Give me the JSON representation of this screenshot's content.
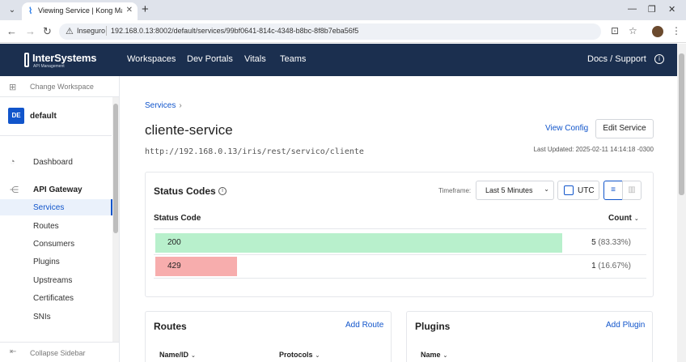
{
  "browser": {
    "tab_title": "Viewing Service | Kong Manager",
    "insecure_label": "Inseguro",
    "url": "192.168.0.13:8002/default/services/99bf0641-814c-4348-b8bc-8f8b7eba56f5"
  },
  "header": {
    "logo": "InterSystems",
    "logo_sub": "API Management",
    "nav": [
      "Workspaces",
      "Dev Portals",
      "Vitals",
      "Teams"
    ],
    "docs": "Docs / Support"
  },
  "sidebar": {
    "change_workspace": "Change Workspace",
    "workspace_badge": "DE",
    "workspace_name": "default",
    "dashboard": "Dashboard",
    "api_gateway": "API Gateway",
    "items": [
      "Services",
      "Routes",
      "Consumers",
      "Plugins",
      "Upstreams",
      "Certificates",
      "SNIs"
    ],
    "collapse": "Collapse Sidebar"
  },
  "service": {
    "breadcrumb": "Services",
    "name": "cliente-service",
    "url": "http://192.168.0.13/iris/rest/servico/cliente",
    "last_updated": "Last Updated: 2025-02-11 14:14:18 -0300",
    "view_config": "View Config",
    "edit_service": "Edit Service"
  },
  "status_codes": {
    "title": "Status Codes",
    "timeframe_label": "Timeframe:",
    "timeframe_value": "Last 5 Minutes",
    "utc_label": "UTC",
    "col_code": "Status Code",
    "col_count": "Count",
    "rows": [
      {
        "code": "200",
        "count": "5",
        "pct": "(83.33%)",
        "share": 0.8333,
        "color": "#b8f0cc"
      },
      {
        "code": "429",
        "count": "1",
        "pct": "(16.67%)",
        "share": 0.1667,
        "color": "#f7adad"
      }
    ]
  },
  "routes": {
    "title": "Routes",
    "add": "Add Route",
    "col1": "Name/ID",
    "col2": "Protocols"
  },
  "plugins": {
    "title": "Plugins",
    "add": "Add Plugin",
    "col1": "Name"
  }
}
